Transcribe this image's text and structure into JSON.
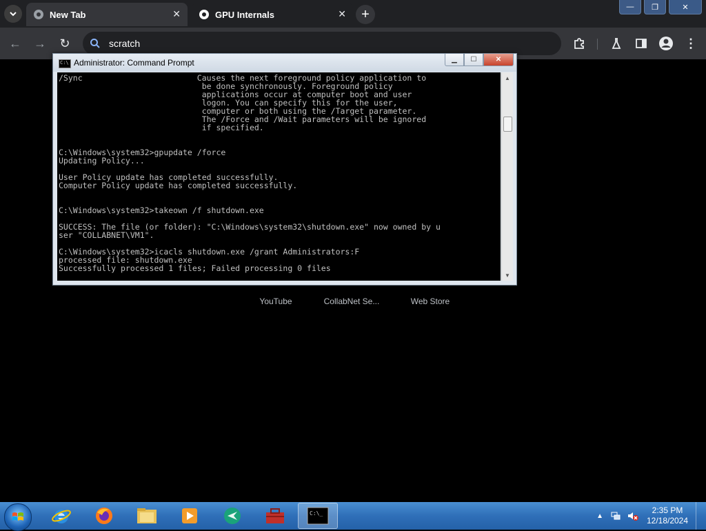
{
  "browser": {
    "tabs": [
      {
        "title": "New Tab",
        "active": true
      },
      {
        "title": "GPU Internals",
        "active": false
      }
    ],
    "omnibox_text": "scratch",
    "shortcuts": [
      "YouTube",
      "CollabNet Se...",
      "Web Store"
    ]
  },
  "cmd": {
    "title": "Administrator: Command Prompt",
    "lines": [
      "/Sync                        Causes the next foreground policy application to",
      "                              be done synchronously. Foreground policy",
      "                              applications occur at computer boot and user",
      "                              logon. You can specify this for the user,",
      "                              computer or both using the /Target parameter.",
      "                              The /Force and /Wait parameters will be ignored",
      "                              if specified.",
      "",
      "",
      "C:\\Windows\\system32>gpupdate /force",
      "Updating Policy...",
      "",
      "User Policy update has completed successfully.",
      "Computer Policy update has completed successfully.",
      "",
      "",
      "C:\\Windows\\system32>takeown /f shutdown.exe",
      "",
      "SUCCESS: The file (or folder): \"C:\\Windows\\system32\\shutdown.exe\" now owned by u",
      "ser \"COLLABNET\\VM1\".",
      "",
      "C:\\Windows\\system32>icacls shutdown.exe /grant Administrators:F",
      "processed file: shutdown.exe",
      "Successfully processed 1 files; Failed processing 0 files"
    ]
  },
  "taskbar": {
    "apps": [
      "internet-explorer",
      "firefox",
      "file-explorer",
      "media-player",
      "teamviewer",
      "toolbox",
      "command-prompt"
    ],
    "time": "2:35 PM",
    "date": "12/18/2024"
  }
}
